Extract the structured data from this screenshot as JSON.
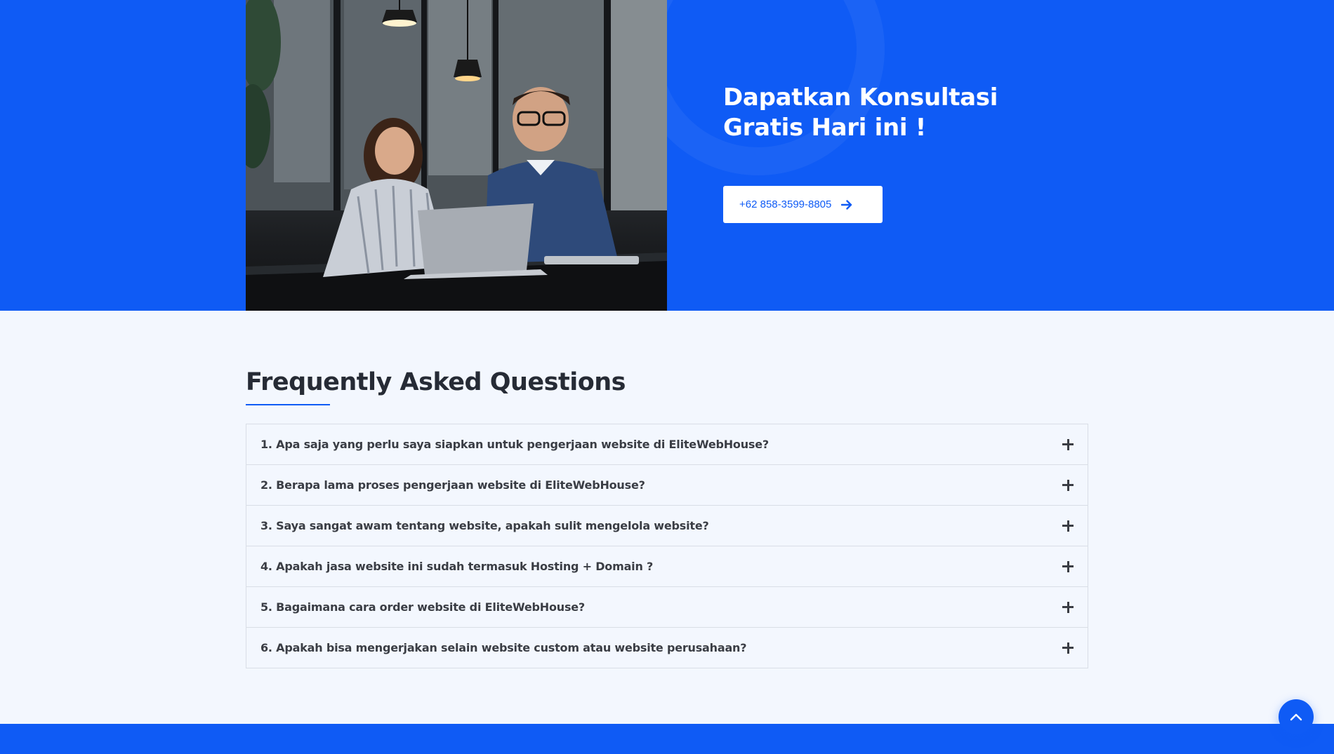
{
  "cta": {
    "title_line1": "Dapatkan Konsultasi",
    "title_line2": "Gratis Hari ini !",
    "phone_label": "+62 858-3599-8805",
    "photo_description_icon": "office-meeting-photo"
  },
  "faq": {
    "heading": "Frequently Asked Questions",
    "items": [
      {
        "question": "1. Apa saja yang perlu saya siapkan untuk pengerjaan website di EliteWebHouse?"
      },
      {
        "question": "2. Berapa lama proses pengerjaan website di EliteWebHouse?"
      },
      {
        "question": "3. Saya sangat awam tentang website, apakah sulit mengelola website?"
      },
      {
        "question": "4. Apakah jasa website ini sudah termasuk Hosting + Domain ?"
      },
      {
        "question": "5. Bagaimana cara order website di EliteWebHouse?"
      },
      {
        "question": "6. Apakah bisa mengerjakan selain website custom atau website perusahaan?"
      }
    ],
    "expand_icon": "plus-icon"
  },
  "colors": {
    "brand_blue": "#0f5bf5",
    "page_bg": "#f3f7fe",
    "heading_text": "#262b35"
  },
  "scroll_top_icon": "chevron-up-icon"
}
